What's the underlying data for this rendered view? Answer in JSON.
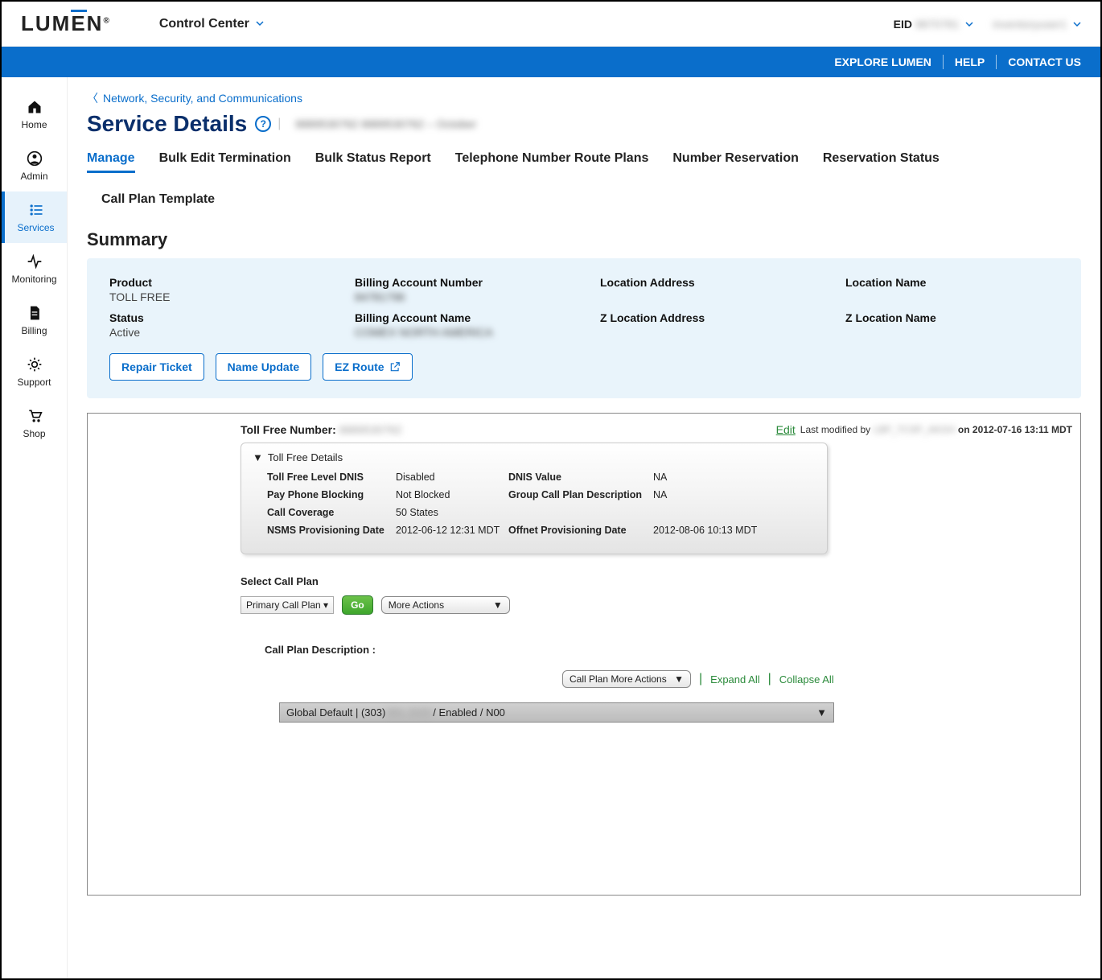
{
  "header": {
    "brand": "LUMEN",
    "control_center": "Control Center",
    "eid_label": "EID",
    "eid_value": "9870781",
    "username": "inventoryuser1"
  },
  "topbar": {
    "explore": "EXPLORE LUMEN",
    "help": "HELP",
    "contact": "CONTACT US"
  },
  "sidebar": {
    "items": [
      {
        "label": "Home"
      },
      {
        "label": "Admin"
      },
      {
        "label": "Services"
      },
      {
        "label": "Monitoring"
      },
      {
        "label": "Billing"
      },
      {
        "label": "Support"
      },
      {
        "label": "Shop"
      }
    ]
  },
  "breadcrumb": {
    "back": "Network, Security, and Communications"
  },
  "title": "Service Details",
  "title_extra": "8889530762   8889530762 – October",
  "tabs": {
    "row1": [
      "Manage",
      "Bulk Edit Termination",
      "Bulk Status Report",
      "Telephone Number Route Plans",
      "Number Reservation",
      "Reservation Status"
    ],
    "row2": [
      "Call Plan Template"
    ]
  },
  "summary_heading": "Summary",
  "summary": {
    "product_label": "Product",
    "product_value": "TOLL FREE",
    "ban_label": "Billing Account Number",
    "ban_value": "84781796",
    "loc_addr_label": "Location Address",
    "loc_addr_value": "",
    "loc_name_label": "Location Name",
    "loc_name_value": "",
    "status_label": "Status",
    "status_value": "Active",
    "baname_label": "Billing Account Name",
    "baname_value": "COMEX NORTH AMERICA",
    "zloc_addr_label": "Z Location Address",
    "zloc_addr_value": "",
    "zloc_name_label": "Z Location Name",
    "zloc_name_value": ""
  },
  "buttons": {
    "repair": "Repair Ticket",
    "name_update": "Name Update",
    "ez_route": "EZ Route"
  },
  "frame": {
    "tf_label": "Toll Free Number:",
    "tf_value": "8889530762",
    "edit": "Edit",
    "last_mod_prefix": "Last modified by",
    "last_mod_by": "LBP_TCSP_AKGH",
    "last_mod_on": "on 2012-07-16 13:11 MDT",
    "details_header": "Toll Free Details",
    "kv": {
      "dnis_k": "Toll Free Level DNIS",
      "dnis_v": "Disabled",
      "dnisval_k": "DNIS Value",
      "dnisval_v": "NA",
      "ppb_k": "Pay Phone Blocking",
      "ppb_v": "Not Blocked",
      "gcpd_k": "Group Call Plan Description",
      "gcpd_v": "NA",
      "cc_k": "Call Coverage",
      "cc_v": "50 States",
      "nsms_k": "NSMS Provisioning Date",
      "nsms_v": "2012-06-12 12:31 MDT",
      "off_k": "Offnet Provisioning Date",
      "off_v": "2012-08-06 10:13 MDT"
    },
    "select_call_plan": "Select Call Plan",
    "call_plan_option": "Primary Call Plan",
    "go": "Go",
    "more_actions": "More Actions",
    "cp_desc": "Call Plan Description :",
    "cp_more": "Call Plan More Actions",
    "expand": "Expand All",
    "collapse": "Collapse All",
    "gd_prefix": "Global Default | (303)",
    "gd_mid": "891-2020",
    "gd_suffix": " / Enabled / N00"
  }
}
